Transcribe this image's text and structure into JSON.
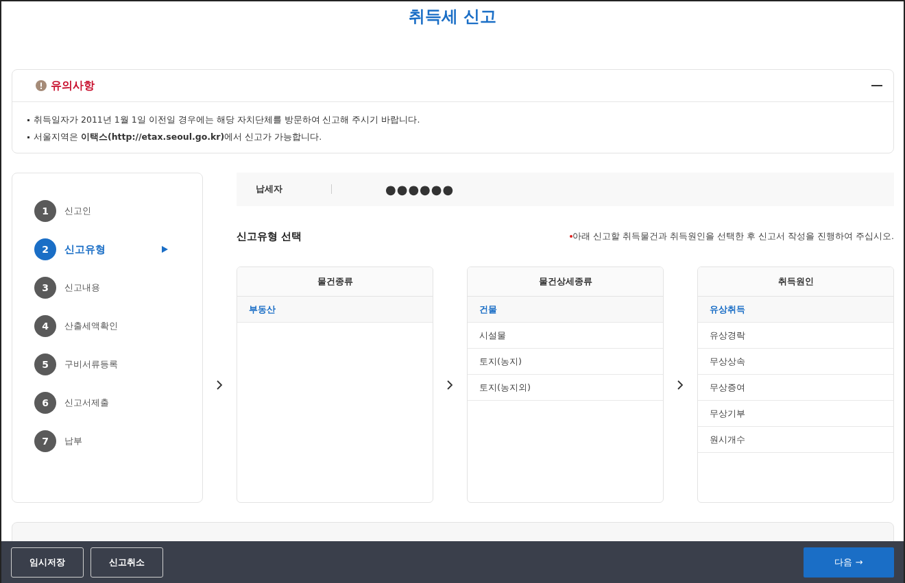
{
  "title": "취득세 신고",
  "notice": {
    "title": "유의사항",
    "lines": [
      "취득일자가 2011년 1월 1일 이전일 경우에는 해당 자치단체를 방문하여 신고해 주시기 바랍니다.",
      "서울지역은 **이택스(http://etax.seoul.go.kr)**에서 신고가 가능합니다."
    ]
  },
  "steps": [
    {
      "number": "1",
      "label": "신고인",
      "selected": false
    },
    {
      "number": "2",
      "label": "신고유형",
      "selected": true
    },
    {
      "number": "3",
      "label": "신고내용",
      "selected": false
    },
    {
      "number": "4",
      "label": "산출세액확인",
      "selected": false
    },
    {
      "number": "5",
      "label": "구비서류등록",
      "selected": false
    },
    {
      "number": "6",
      "label": "신고서제출",
      "selected": false
    },
    {
      "number": "7",
      "label": "납부",
      "selected": false
    }
  ],
  "taxpayer": {
    "label": "납세자",
    "value": "●●●●●●"
  },
  "section": {
    "title": "신고유형 선택",
    "hint": "아래 신고할 취득물건과 취득원인을 선택한 후 신고서 작성을 진행하여 주십시오."
  },
  "columns": [
    {
      "heading": "물건종류",
      "items": [
        {
          "label": "부동산",
          "selected": true
        }
      ]
    },
    {
      "heading": "물건상세종류",
      "items": [
        {
          "label": "건물",
          "selected": true
        },
        {
          "label": "시설물",
          "selected": false
        },
        {
          "label": "토지(농지)",
          "selected": false
        },
        {
          "label": "토지(농지외)",
          "selected": false
        }
      ]
    },
    {
      "heading": "취득원인",
      "items": [
        {
          "label": "유상취득",
          "selected": true
        },
        {
          "label": "유상경락",
          "selected": false
        },
        {
          "label": "무상상속",
          "selected": false
        },
        {
          "label": "무상증여",
          "selected": false
        },
        {
          "label": "무상기부",
          "selected": false
        },
        {
          "label": "원시개수",
          "selected": false
        }
      ]
    }
  ],
  "footer": {
    "left_buttons": [
      "임시저장",
      "신고취소"
    ],
    "next": "다음 →"
  }
}
